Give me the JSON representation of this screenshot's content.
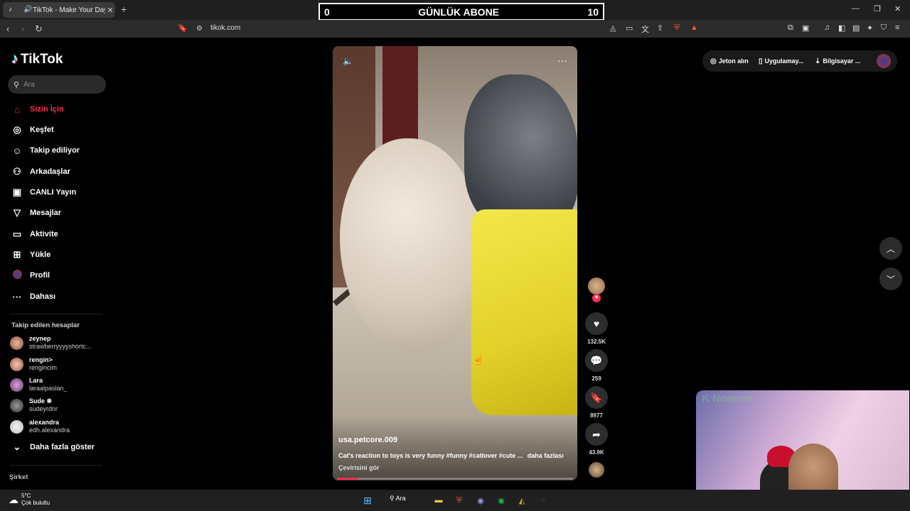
{
  "browser": {
    "tab_title": "TikTok - Make Your Day",
    "url": "tikok.com"
  },
  "overlay": {
    "left_count": "0",
    "title": "GÜNLÜK ABONE",
    "right_count": "10"
  },
  "sidebar": {
    "logo": "TikTok",
    "search_placeholder": "Ara",
    "nav": [
      {
        "label": "Sizin İçin",
        "icon": "home-icon",
        "active": true
      },
      {
        "label": "Keşfet",
        "icon": "compass-icon"
      },
      {
        "label": "Takip ediliyor",
        "icon": "following-icon"
      },
      {
        "label": "Arkadaşlar",
        "icon": "friends-icon"
      },
      {
        "label": "CANLI Yayın",
        "icon": "live-tv-icon"
      },
      {
        "label": "Mesajlar",
        "icon": "send-icon"
      },
      {
        "label": "Aktivite",
        "icon": "inbox-icon"
      },
      {
        "label": "Yükle",
        "icon": "upload-icon"
      },
      {
        "label": "Profil",
        "icon": "profile-icon"
      },
      {
        "label": "Dahası",
        "icon": "more-icon"
      }
    ],
    "following_title": "Takip edilen hesaplar",
    "following": [
      {
        "name": "zeynep",
        "handle": "strawberryyyyshortc..."
      },
      {
        "name": "rengin>",
        "handle": "rengincim"
      },
      {
        "name": "Lara",
        "handle": "laraalpaslan_"
      },
      {
        "name": "Sude ❄",
        "handle": "sudeyrdnr"
      },
      {
        "name": "alexandra",
        "handle": "edh.alexandra"
      }
    ],
    "show_more": "Daha fazla göster",
    "company": "Şirket"
  },
  "video": {
    "author": "usa.petcore.009",
    "description": "Cat's reaction to toys is very funny #funny #catlover #cute ...",
    "more": "daha fazlası",
    "translate": "Çevirisini gör",
    "progress": 0.09
  },
  "actions": {
    "likes": "132.5K",
    "comments": "259",
    "saves": "8977",
    "shares": "43.9K"
  },
  "topright": {
    "coins": "Jeton alın",
    "app": "Uygulamay...",
    "pc": "Bilgisayar ..."
  },
  "webcam": {
    "tag": "K Nomore"
  },
  "taskbar": {
    "temp": "5°C",
    "weather": "Çok bulutlu",
    "search": "Ara"
  },
  "colors": {
    "accent": "#fe2c55",
    "background": "#000000"
  }
}
